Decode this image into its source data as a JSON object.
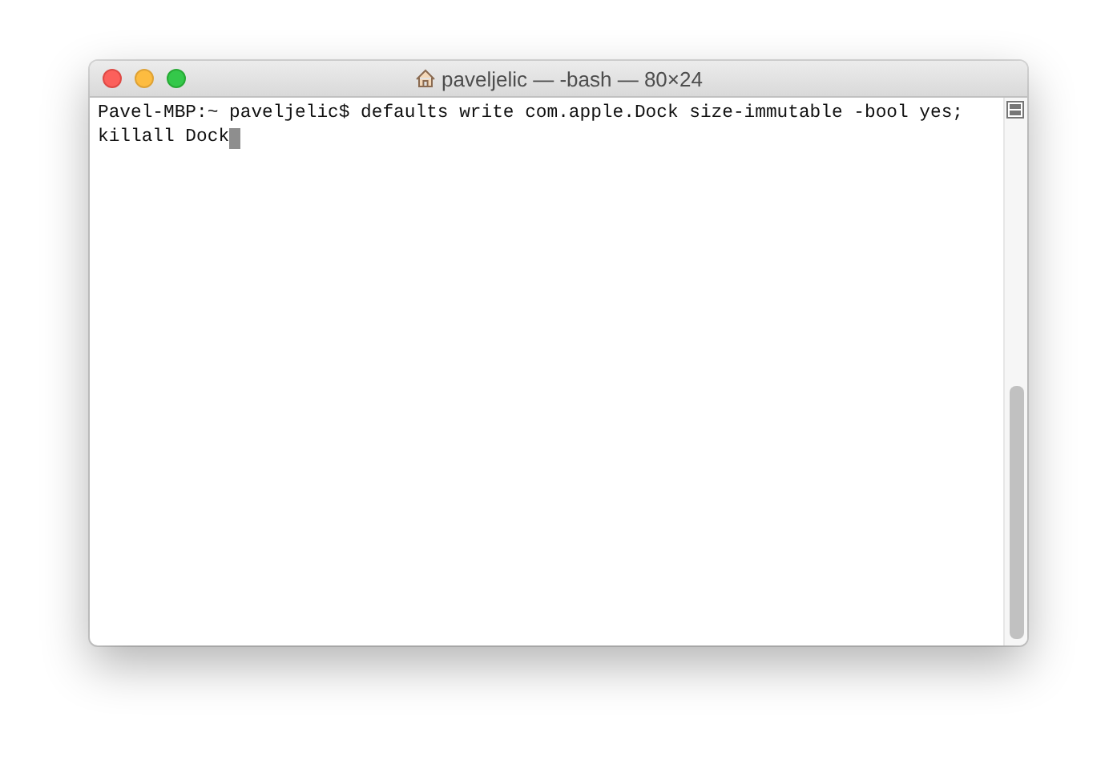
{
  "window": {
    "title": "paveljelic — -bash — 80×24"
  },
  "terminal": {
    "lines": [
      "Pavel-MBP:~ paveljelic$ defaults write com.apple.Dock size-immutable -bool yes;",
      "killall Dock"
    ],
    "cursor": true
  }
}
